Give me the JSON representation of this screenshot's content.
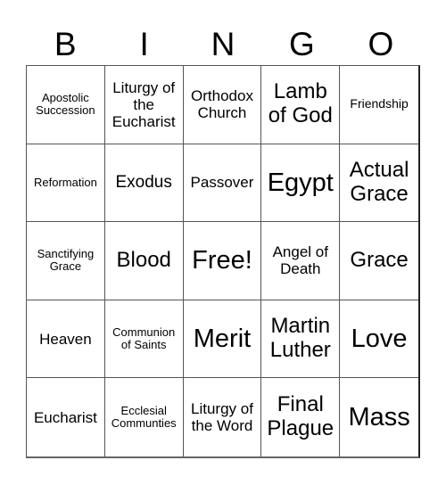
{
  "header": {
    "letters": [
      "B",
      "I",
      "N",
      "G",
      "O"
    ]
  },
  "cells": [
    {
      "text": "Apostolic Succession",
      "size": "s-xs"
    },
    {
      "text": "Liturgy of the Eucharist",
      "size": "s-md"
    },
    {
      "text": "Orthodox Church",
      "size": "s-md"
    },
    {
      "text": "Lamb of God",
      "size": "s-xl"
    },
    {
      "text": "Friendship",
      "size": "s-sm"
    },
    {
      "text": "Reformation",
      "size": "s-xs"
    },
    {
      "text": "Exodus",
      "size": "s-lg"
    },
    {
      "text": "Passover",
      "size": "s-md"
    },
    {
      "text": "Egypt",
      "size": "s-xxl"
    },
    {
      "text": "Actual Grace",
      "size": "s-xl"
    },
    {
      "text": "Sanctifying Grace",
      "size": "s-xs"
    },
    {
      "text": "Blood",
      "size": "s-xl"
    },
    {
      "text": "Free!",
      "size": "s-xxl"
    },
    {
      "text": "Angel of Death",
      "size": "s-md"
    },
    {
      "text": "Grace",
      "size": "s-xl"
    },
    {
      "text": "Heaven",
      "size": "s-md"
    },
    {
      "text": "Communion of Saints",
      "size": "s-xs"
    },
    {
      "text": "Merit",
      "size": "s-xxl"
    },
    {
      "text": "Martin Luther",
      "size": "s-xl"
    },
    {
      "text": "Love",
      "size": "s-xxl"
    },
    {
      "text": "Eucharist",
      "size": "s-md"
    },
    {
      "text": "Ecclesial Communties",
      "size": "s-xs"
    },
    {
      "text": "Liturgy of the Word",
      "size": "s-md"
    },
    {
      "text": "Final Plague",
      "size": "s-xl"
    },
    {
      "text": "Mass",
      "size": "s-xxl"
    }
  ]
}
